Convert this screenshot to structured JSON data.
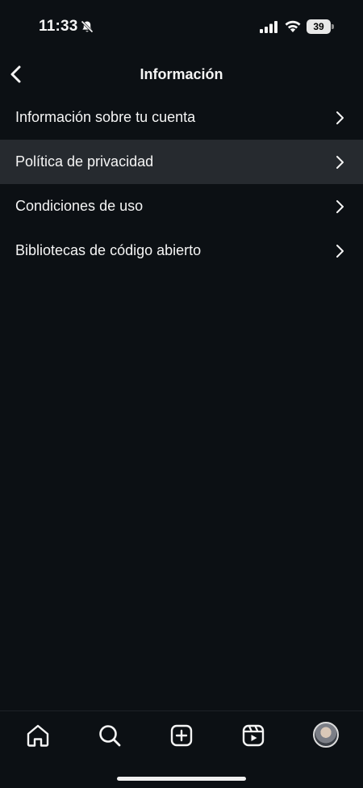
{
  "status_bar": {
    "time": "11:33",
    "battery_level": "39",
    "icons": [
      "bell-slash-icon",
      "signal-icon",
      "wifi-icon",
      "battery-icon"
    ]
  },
  "header": {
    "title": "Información",
    "back_icon": "chevron-left-icon"
  },
  "menu": {
    "items": [
      {
        "label": "Información sobre tu cuenta",
        "highlighted": false
      },
      {
        "label": "Política de privacidad",
        "highlighted": true
      },
      {
        "label": "Condiciones de uso",
        "highlighted": false
      },
      {
        "label": "Bibliotecas de código abierto",
        "highlighted": false
      }
    ],
    "chevron_icon": "chevron-right-icon"
  },
  "tab_bar": {
    "tabs": [
      "home-icon",
      "search-icon",
      "create-post-icon",
      "reels-icon",
      "profile-avatar"
    ]
  },
  "colors": {
    "background": "#0c1014",
    "highlight": "#262a2f",
    "text": "#f5f5f5"
  }
}
